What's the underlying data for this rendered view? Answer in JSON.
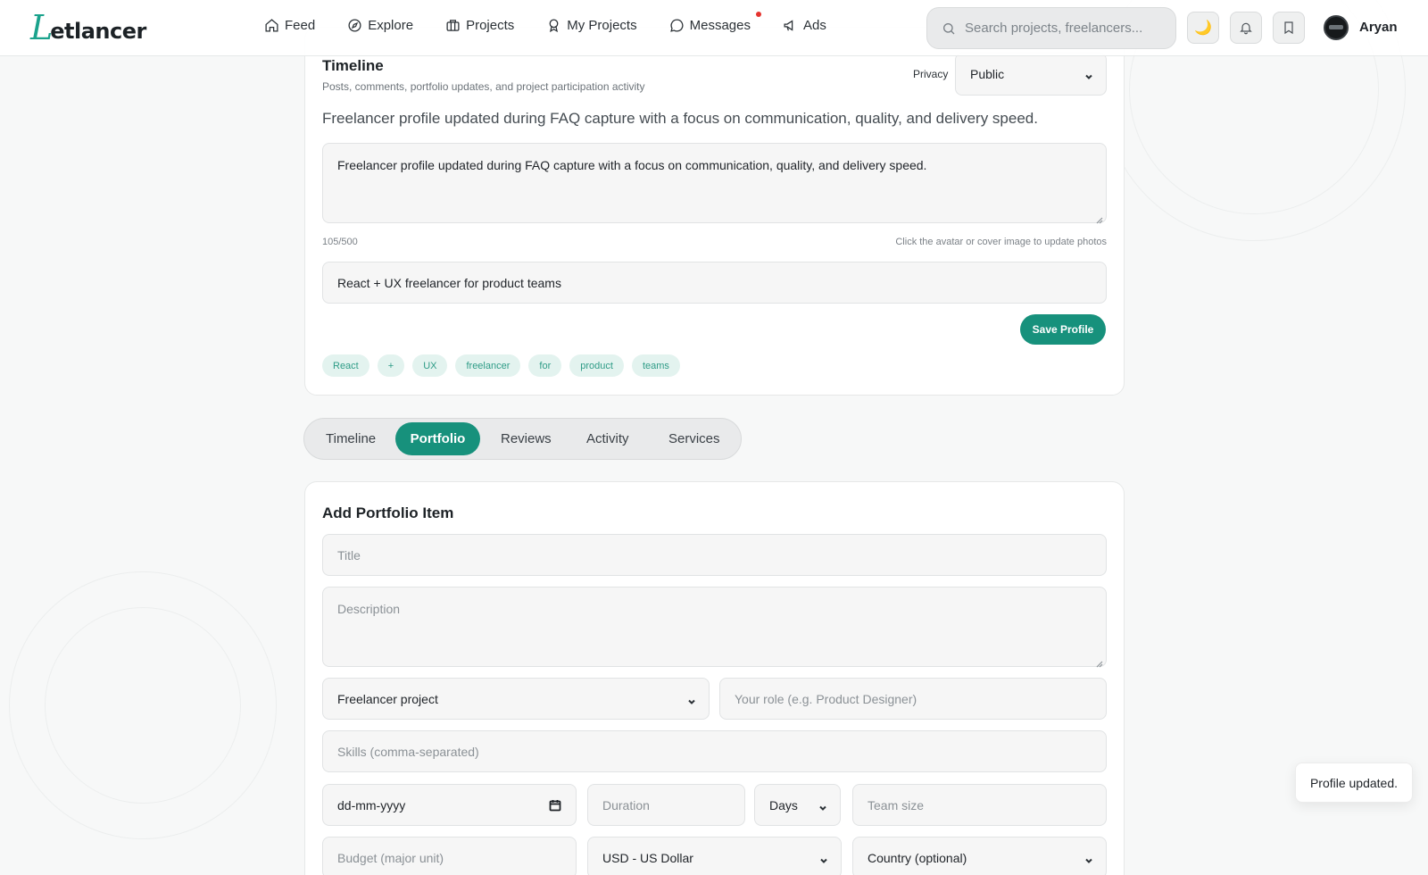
{
  "brand": {
    "logo_letter": "L",
    "logo_rest": "etlancer",
    "accent": "#17917c"
  },
  "nav": {
    "items": [
      {
        "label": "Feed",
        "icon": "home-icon"
      },
      {
        "label": "Explore",
        "icon": "compass-icon"
      },
      {
        "label": "Projects",
        "icon": "briefcase-icon"
      },
      {
        "label": "My Projects",
        "icon": "award-icon"
      },
      {
        "label": "Messages",
        "icon": "message-icon",
        "notification_dot": true
      },
      {
        "label": "Ads",
        "icon": "megaphone-icon"
      }
    ],
    "search_placeholder": "Search projects, freelancers...",
    "theme_icon": "moon-icon",
    "user_name": "Aryan"
  },
  "profile": {
    "section_title": "Timeline",
    "section_subtitle": "Posts, comments, portfolio updates, and project participation activity",
    "privacy_label": "Privacy",
    "privacy_value": "Public",
    "bio_display": "Freelancer profile updated during FAQ capture with a focus on communication, quality, and delivery speed.",
    "bio_input": "Freelancer profile updated during FAQ capture with a focus on communication, quality, and delivery speed.",
    "char_count": "105/500",
    "photo_hint": "Click the avatar or cover image to update photos",
    "headline_input": "React + UX freelancer for product teams",
    "save_label": "Save Profile",
    "tags": [
      "React",
      "+",
      "UX",
      "freelancer",
      "for",
      "product",
      "teams"
    ]
  },
  "tabs": {
    "items": [
      "Timeline",
      "Portfolio",
      "Reviews",
      "Activity",
      "Services"
    ],
    "active": "Portfolio"
  },
  "portfolio_form": {
    "title": "Add Portfolio Item",
    "title_placeholder": "Title",
    "description_placeholder": "Description",
    "project_type_value": "Freelancer project",
    "role_placeholder": "Your role (e.g. Product Designer)",
    "skills_placeholder": "Skills (comma-separated)",
    "date_value": "dd-mm-yyyy",
    "duration_placeholder": "Duration",
    "duration_unit_value": "Days",
    "team_size_placeholder": "Team size",
    "budget_placeholder": "Budget (major unit)",
    "currency_value": "USD - US Dollar",
    "country_value": "Country (optional)"
  },
  "toast": {
    "message": "Profile updated."
  }
}
